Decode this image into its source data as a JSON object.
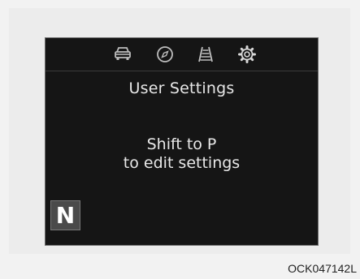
{
  "screen": {
    "tabs": [
      {
        "icon": "car-icon"
      },
      {
        "icon": "compass-icon"
      },
      {
        "icon": "lane-icon"
      },
      {
        "icon": "gear-icon",
        "active": true
      }
    ],
    "title": "User Settings",
    "message_line1": "Shift to P",
    "message_line2": "to edit settings",
    "gear_indicator": "N"
  },
  "caption": "OCK047142L"
}
